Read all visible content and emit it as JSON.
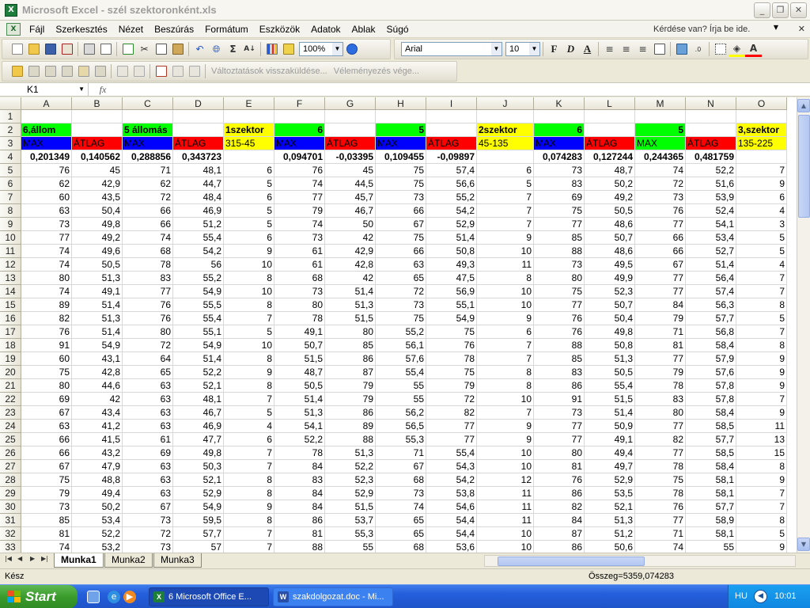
{
  "window": {
    "title": "Microsoft Excel - szél szektoronként.xls",
    "minimize": "_",
    "restore": "❐",
    "close": "✕"
  },
  "menu": {
    "items": [
      "Fájl",
      "Szerkesztés",
      "Nézet",
      "Beszúrás",
      "Formátum",
      "Eszközök",
      "Adatok",
      "Ablak",
      "Súgó"
    ],
    "help_placeholder": "Kérdése van? Írja be ide.",
    "doc_close": "✕"
  },
  "toolbar": {
    "zoom": "100%",
    "font_name": "Arial",
    "font_size": "10",
    "bold": "F",
    "italic": "D",
    "underline": "A",
    "review_reply": "Változtatások visszaküldése...",
    "review_end": "Véleményezés vége..."
  },
  "formula_bar": {
    "name_box": "K1",
    "fx": "fx",
    "content": ""
  },
  "grid": {
    "columns": [
      "A",
      "B",
      "C",
      "D",
      "E",
      "F",
      "G",
      "H",
      "I",
      "J",
      "K",
      "L",
      "M",
      "N",
      "O"
    ],
    "row_numbers": [
      "1",
      "2",
      "3",
      "4",
      "5",
      "6",
      "7",
      "8",
      "9",
      "10",
      "11",
      "12",
      "13",
      "14",
      "15",
      "16",
      "17",
      "18",
      "19",
      "20",
      "21",
      "22",
      "23",
      "24",
      "25",
      "26",
      "27",
      "28",
      "29",
      "30",
      "31",
      "32",
      "33"
    ],
    "header_row2": [
      "6,állom",
      "",
      "5 állomás",
      "",
      "1szektor",
      "6",
      "",
      "5",
      "",
      "2szektor",
      "6",
      "",
      "5",
      "",
      "3,szektor"
    ],
    "header_row3": [
      "MAX",
      "ÁTLAG",
      "MAX",
      "ÁTLAG",
      "315-45",
      "MAX",
      "ÁTLAG",
      "MAX",
      "ÁTLAG",
      "45-135",
      "MAX",
      "ÁTLAG",
      "MAX",
      "ÁTLAG",
      "135-225"
    ],
    "header_row4": [
      "0,201349",
      "0,140562",
      "0,288856",
      "0,343723",
      "",
      "0,094701",
      "-0,03395",
      "0,109455",
      "-0,09897",
      "",
      "0,074283",
      "0,127244",
      "0,244365",
      "0,481759",
      ""
    ],
    "data_rows": [
      [
        "76",
        "45",
        "71",
        "48,1",
        "6",
        "76",
        "45",
        "75",
        "57,4",
        "6",
        "73",
        "48,7",
        "74",
        "52,2",
        "7"
      ],
      [
        "62",
        "42,9",
        "62",
        "44,7",
        "5",
        "74",
        "44,5",
        "75",
        "56,6",
        "5",
        "83",
        "50,2",
        "72",
        "51,6",
        "9"
      ],
      [
        "60",
        "43,5",
        "72",
        "48,4",
        "6",
        "77",
        "45,7",
        "73",
        "55,2",
        "7",
        "69",
        "49,2",
        "73",
        "53,9",
        "6"
      ],
      [
        "63",
        "50,4",
        "66",
        "46,9",
        "5",
        "79",
        "46,7",
        "66",
        "54,2",
        "7",
        "75",
        "50,5",
        "76",
        "52,4",
        "4"
      ],
      [
        "73",
        "49,8",
        "66",
        "51,2",
        "5",
        "74",
        "50",
        "67",
        "52,9",
        "7",
        "77",
        "48,6",
        "77",
        "54,1",
        "3"
      ],
      [
        "77",
        "49,2",
        "74",
        "55,4",
        "6",
        "73",
        "42",
        "75",
        "51,4",
        "9",
        "85",
        "50,7",
        "66",
        "53,4",
        "5"
      ],
      [
        "74",
        "49,6",
        "68",
        "54,2",
        "9",
        "61",
        "42,9",
        "66",
        "50,8",
        "10",
        "88",
        "48,6",
        "66",
        "52,7",
        "5"
      ],
      [
        "74",
        "50,5",
        "78",
        "56",
        "10",
        "61",
        "42,8",
        "63",
        "49,3",
        "11",
        "73",
        "49,5",
        "67",
        "51,4",
        "4"
      ],
      [
        "80",
        "51,3",
        "83",
        "55,2",
        "8",
        "68",
        "42",
        "65",
        "47,5",
        "8",
        "80",
        "49,9",
        "77",
        "56,4",
        "7"
      ],
      [
        "74",
        "49,1",
        "77",
        "54,9",
        "10",
        "73",
        "51,4",
        "72",
        "56,9",
        "10",
        "75",
        "52,3",
        "77",
        "57,4",
        "7"
      ],
      [
        "89",
        "51,4",
        "76",
        "55,5",
        "8",
        "80",
        "51,3",
        "73",
        "55,1",
        "10",
        "77",
        "50,7",
        "84",
        "56,3",
        "8"
      ],
      [
        "82",
        "51,3",
        "76",
        "55,4",
        "7",
        "78",
        "51,5",
        "75",
        "54,9",
        "9",
        "76",
        "50,4",
        "79",
        "57,7",
        "5"
      ],
      [
        "76",
        "51,4",
        "80",
        "55,1",
        "5",
        "49,1",
        "80",
        "55,2",
        "75",
        "6",
        "76",
        "49,8",
        "71",
        "56,8",
        "7"
      ],
      [
        "91",
        "54,9",
        "72",
        "54,9",
        "10",
        "50,7",
        "85",
        "56,1",
        "76",
        "7",
        "88",
        "50,8",
        "81",
        "58,4",
        "8"
      ],
      [
        "60",
        "43,1",
        "64",
        "51,4",
        "8",
        "51,5",
        "86",
        "57,6",
        "78",
        "7",
        "85",
        "51,3",
        "77",
        "57,9",
        "9"
      ],
      [
        "75",
        "42,8",
        "65",
        "52,2",
        "9",
        "48,7",
        "87",
        "55,4",
        "75",
        "8",
        "83",
        "50,5",
        "79",
        "57,6",
        "9"
      ],
      [
        "80",
        "44,6",
        "63",
        "52,1",
        "8",
        "50,5",
        "79",
        "55",
        "79",
        "8",
        "86",
        "55,4",
        "78",
        "57,8",
        "9"
      ],
      [
        "69",
        "42",
        "63",
        "48,1",
        "7",
        "51,4",
        "79",
        "55",
        "72",
        "10",
        "91",
        "51,5",
        "83",
        "57,8",
        "7"
      ],
      [
        "67",
        "43,4",
        "63",
        "46,7",
        "5",
        "51,3",
        "86",
        "56,2",
        "82",
        "7",
        "73",
        "51,4",
        "80",
        "58,4",
        "9"
      ],
      [
        "63",
        "41,2",
        "63",
        "46,9",
        "4",
        "54,1",
        "89",
        "56,5",
        "77",
        "9",
        "77",
        "50,9",
        "77",
        "58,5",
        "11"
      ],
      [
        "66",
        "41,5",
        "61",
        "47,7",
        "6",
        "52,2",
        "88",
        "55,3",
        "77",
        "9",
        "77",
        "49,1",
        "82",
        "57,7",
        "13"
      ],
      [
        "66",
        "43,2",
        "69",
        "49,8",
        "7",
        "78",
        "51,3",
        "71",
        "55,4",
        "10",
        "80",
        "49,4",
        "77",
        "58,5",
        "15"
      ],
      [
        "67",
        "47,9",
        "63",
        "50,3",
        "7",
        "84",
        "52,2",
        "67",
        "54,3",
        "10",
        "81",
        "49,7",
        "78",
        "58,4",
        "8"
      ],
      [
        "75",
        "48,8",
        "63",
        "52,1",
        "8",
        "83",
        "52,3",
        "68",
        "54,2",
        "12",
        "76",
        "52,9",
        "75",
        "58,1",
        "9"
      ],
      [
        "79",
        "49,4",
        "63",
        "52,9",
        "8",
        "84",
        "52,9",
        "73",
        "53,8",
        "11",
        "86",
        "53,5",
        "78",
        "58,1",
        "7"
      ],
      [
        "73",
        "50,2",
        "67",
        "54,9",
        "9",
        "84",
        "51,5",
        "74",
        "54,6",
        "11",
        "82",
        "52,1",
        "76",
        "57,7",
        "7"
      ],
      [
        "85",
        "53,4",
        "73",
        "59,5",
        "8",
        "86",
        "53,7",
        "65",
        "54,4",
        "11",
        "84",
        "51,3",
        "77",
        "58,9",
        "8"
      ],
      [
        "81",
        "52,2",
        "72",
        "57,7",
        "7",
        "81",
        "55,3",
        "65",
        "54,4",
        "10",
        "87",
        "51,2",
        "71",
        "58,1",
        "5"
      ],
      [
        "74",
        "53,2",
        "73",
        "57",
        "7",
        "88",
        "55",
        "68",
        "53,6",
        "10",
        "86",
        "50,6",
        "74",
        "55",
        "9"
      ]
    ]
  },
  "sheets": {
    "tabs": [
      "Munka1",
      "Munka2",
      "Munka3"
    ],
    "active": "Munka1"
  },
  "status": {
    "ready": "Kész",
    "sum": "Összeg=5359,074283"
  },
  "taskbar": {
    "start": "Start",
    "tasks": [
      "6 Microsoft Office E...",
      "szakdolgozat.doc - Mi..."
    ],
    "lang": "HU",
    "clock": "10:01"
  },
  "colors": {
    "green": "#00ff00",
    "blue": "#0000ff",
    "red": "#ff0000",
    "yellow": "#ffff00"
  }
}
